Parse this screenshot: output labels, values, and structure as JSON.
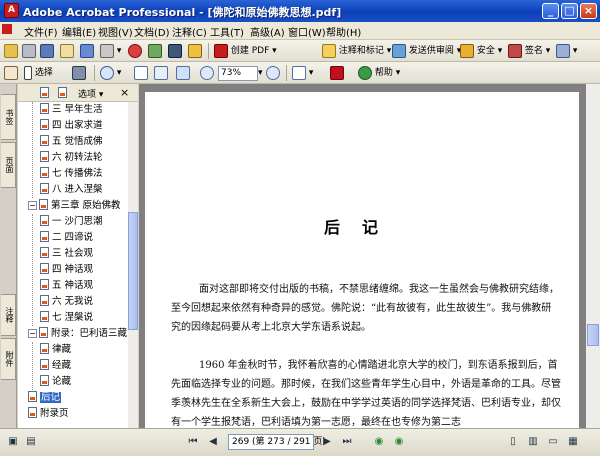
{
  "window": {
    "title": "Adobe Acrobat Professional - [佛陀和原始佛教思想.pdf]"
  },
  "menu": [
    "文件(F)",
    "编辑(E)",
    "视图(V)",
    "文档(D)",
    "注释(C)",
    "工具(T)",
    "高级(A)",
    "窗口(W)",
    "帮助(H)"
  ],
  "toolbar": {
    "create_pdf": "创建 PDF",
    "comment_markup": "注释和标记",
    "send_review": "发送供审阅",
    "secure": "安全",
    "sign": "签名",
    "select": "选择",
    "zoom": "73%",
    "help": "帮助"
  },
  "bookmarks": {
    "options": "选项",
    "tabs": [
      "书签",
      "页面",
      "注释",
      "附件"
    ],
    "items": [
      "三 早年生活",
      "四 出家求道",
      "五 觉悟成佛",
      "六 初转法轮",
      "七 传播佛法",
      "八 进入涅槃",
      "第三章 原始佛教",
      "一 沙门思潮",
      "二 四谛说",
      "三 社会观",
      "四 神话观",
      "五 神话观",
      "六 无我说",
      "七 涅槃说",
      "附录：巴利语三藏",
      "律藏",
      "经藏",
      "论藏",
      "后记",
      "附录页"
    ]
  },
  "document": {
    "heading": "后记",
    "paragraphs": [
      "面对这部即将交付出版的书稿，不禁思绪缠绵。我这一生虽然会与佛教研究结缘，至今回想起来依然有种奇异的感觉。佛陀说：“此有故彼有，此生故彼生”。我与佛教研究的因缘起码要从考上北京大学东语系说起。",
      "1960 年金秋时节，我怀着欣喜的心情踏进北京大学的校门，到东语系报到后，首先面临选择专业的问题。那时候，在我们这些青年学生心目中，外语是革命的工具。尽管季羡林先生在全系新生大会上，鼓励在中学学过英语的同学选择梵语、巴利语专业，却仅有一个学生报梵语，巴利语填为第一志愿，最终在也专修为第二志"
    ]
  },
  "status": {
    "page_field": "269 (第 273 / 291 页)"
  }
}
